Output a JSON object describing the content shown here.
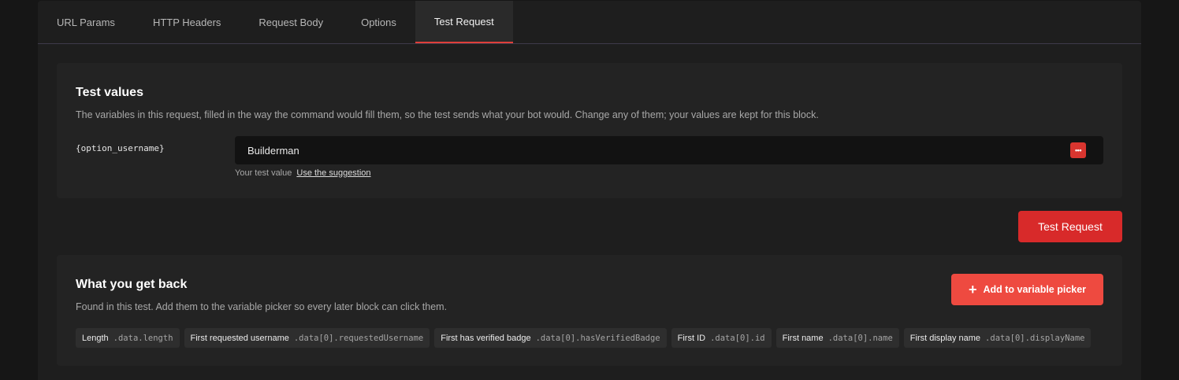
{
  "tabs": [
    "URL Params",
    "HTTP Headers",
    "Request Body",
    "Options",
    "Test Request"
  ],
  "active_tab_index": 4,
  "test_values": {
    "title": "Test values",
    "description": "The variables in this request, filled in the way the command would fill them, so the test sends what your bot would. Change any of them; your values are kept for this block.",
    "variable_name": "{option_username}",
    "input_value": "Builderman",
    "dots_icon": "•••",
    "hint_text": "Your test value",
    "hint_link": "Use the suggestion"
  },
  "test_button_label": "Test Request",
  "results": {
    "title": "What you get back",
    "description": "Found in this test. Add them to the variable picker so every later block can click them.",
    "add_button_label": "Add to variable picker",
    "plus_icon": "+",
    "chips": [
      {
        "label": "Length",
        "path": ".data.length"
      },
      {
        "label": "First requested username",
        "path": ".data[0].requestedUsername"
      },
      {
        "label": "First has verified badge",
        "path": ".data[0].hasVerifiedBadge"
      },
      {
        "label": "First ID",
        "path": ".data[0].id"
      },
      {
        "label": "First name",
        "path": ".data[0].name"
      },
      {
        "label": "First display name",
        "path": ".data[0].displayName"
      }
    ]
  },
  "colors": {
    "accent": "#d82a2a",
    "add_button": "#ee4a40",
    "tab_underline": "#e0403a"
  }
}
